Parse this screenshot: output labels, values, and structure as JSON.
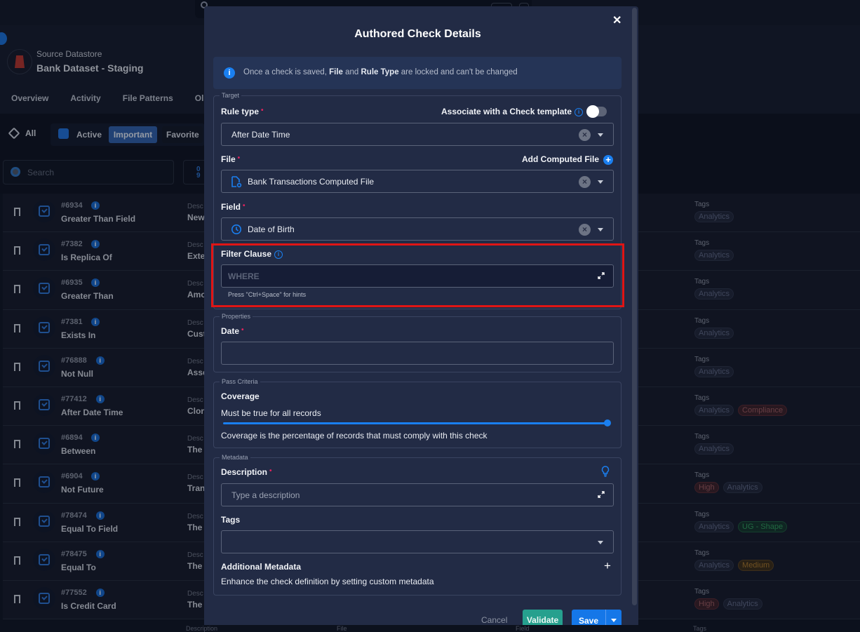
{
  "app": {
    "datastore_label": "Source Datastore",
    "datastore_name": "Bank Dataset - Staging",
    "nav_tabs": [
      "Overview",
      "Activity",
      "File Patterns",
      "Ol"
    ],
    "filters": {
      "all": "All",
      "active": "Active",
      "important": "Important",
      "favorite": "Favorite"
    },
    "search_placeholder": "Search",
    "sort_glyph": "0\n9",
    "desc_label": "Desc",
    "tags_label": "Tags",
    "bottom_labels": [
      "Description",
      "File",
      "Field",
      "Tags"
    ],
    "checks": [
      {
        "id": "#6934",
        "name": "Greater Than Field",
        "desc": "New",
        "tags": [
          {
            "label": "Analytics",
            "kind": "analytics"
          }
        ]
      },
      {
        "id": "#7382",
        "name": "Is Replica Of",
        "desc": "Exte",
        "tags": [
          {
            "label": "Analytics",
            "kind": "analytics"
          }
        ]
      },
      {
        "id": "#6935",
        "name": "Greater Than",
        "desc": "Amo",
        "tags": [
          {
            "label": "Analytics",
            "kind": "analytics"
          }
        ]
      },
      {
        "id": "#7381",
        "name": "Exists In",
        "desc": "Cust",
        "tags": [
          {
            "label": "Analytics",
            "kind": "analytics"
          }
        ]
      },
      {
        "id": "#76888",
        "name": "Not Null",
        "desc": "Asse",
        "tags": [
          {
            "label": "Analytics",
            "kind": "analytics"
          }
        ]
      },
      {
        "id": "#77412",
        "name": "After Date Time",
        "desc": "Clon",
        "tags": [
          {
            "label": "Analytics",
            "kind": "analytics"
          },
          {
            "label": "Compliance",
            "kind": "compliance"
          }
        ]
      },
      {
        "id": "#6894",
        "name": "Between",
        "desc": "The",
        "tags": [
          {
            "label": "Analytics",
            "kind": "analytics"
          }
        ]
      },
      {
        "id": "#6904",
        "name": "Not Future",
        "desc": "Tran",
        "tags": [
          {
            "label": "High",
            "kind": "high"
          },
          {
            "label": "Analytics",
            "kind": "analytics"
          }
        ]
      },
      {
        "id": "#78474",
        "name": "Equal To Field",
        "desc": "The",
        "tags": [
          {
            "label": "Analytics",
            "kind": "analytics"
          },
          {
            "label": "UG - Shape",
            "kind": "ug"
          }
        ]
      },
      {
        "id": "#78475",
        "name": "Equal To",
        "desc": "The",
        "tags": [
          {
            "label": "Analytics",
            "kind": "analytics"
          },
          {
            "label": "Medium",
            "kind": "medium"
          }
        ]
      },
      {
        "id": "#77552",
        "name": "Is Credit Card",
        "desc": "The",
        "tags": [
          {
            "label": "High",
            "kind": "high"
          },
          {
            "label": "Analytics",
            "kind": "analytics"
          }
        ]
      }
    ]
  },
  "modal": {
    "title": "Authored Check Details",
    "close_icon": "close-icon",
    "notice": {
      "pre": "Once a check is saved, ",
      "b1": "File",
      "mid": " and ",
      "b2": "Rule Type",
      "post": " are locked and can't be changed"
    },
    "target": {
      "legend": "Target",
      "rule_type_label": "Rule type",
      "template_label": "Associate with a Check template",
      "template_toggle_on": false,
      "rule_type_value": "After Date Time",
      "file_label": "File",
      "add_computed_label": "Add Computed File",
      "file_value": "Bank Transactions Computed File",
      "field_label": "Field",
      "field_value": "Date of Birth",
      "filter_label": "Filter Clause",
      "filter_placeholder": "WHERE",
      "filter_hint": "Press \"Ctrl+Space\" for hints"
    },
    "properties": {
      "legend": "Properties",
      "date_label": "Date",
      "date_value": ""
    },
    "pass_criteria": {
      "legend": "Pass Criteria",
      "coverage_label": "Coverage",
      "coverage_text": "Must be true for all records",
      "coverage_value_pct": 100,
      "coverage_help": "Coverage is the percentage of records that must comply with this check"
    },
    "metadata": {
      "legend": "Metadata",
      "description_label": "Description",
      "description_placeholder": "Type a description",
      "tags_label": "Tags",
      "additional_label": "Additional Metadata",
      "additional_help": "Enhance the check definition by setting custom metadata"
    },
    "required_mark": "•",
    "buttons": {
      "cancel": "Cancel",
      "validate": "Validate",
      "save": "Save"
    }
  },
  "colors": {
    "accent": "#1a7ff0",
    "validate": "#26a08e",
    "highlight": "#e01515",
    "required": "#e0245e"
  }
}
